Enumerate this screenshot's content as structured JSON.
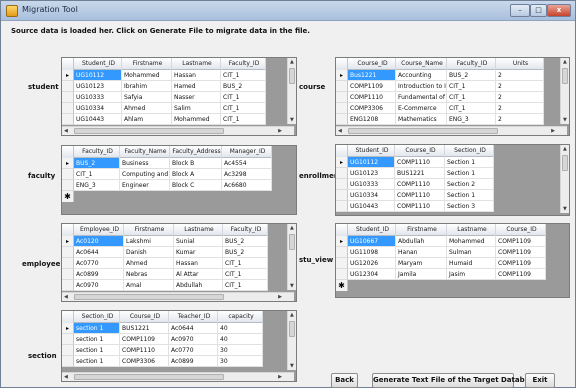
{
  "window": {
    "title": "Migration Tool",
    "minimize": "–",
    "maximize": "□",
    "close": "x"
  },
  "info_text": "Source data is loaded her. Click on Generate File to migrate data in the file.",
  "labels": {
    "student": "student",
    "faculty": "faculty",
    "employee": "employee",
    "section": "section",
    "course": "course",
    "enrollment": "enrollment",
    "stu_view": "stu_view"
  },
  "grids": {
    "student": {
      "columns": [
        "Student_ID",
        "Firstname",
        "Lastname",
        "Faculty_ID"
      ],
      "rows": [
        [
          "UG10112",
          "Mohammed",
          "Hassan",
          "CIT_1"
        ],
        [
          "UG10123",
          "Ibrahim",
          "Hamed",
          "BUS_2"
        ],
        [
          "UG10333",
          "Safyia",
          "Nasser",
          "CIT_1"
        ],
        [
          "UG10334",
          "Ahmed",
          "Salim",
          "CIT_1"
        ],
        [
          "UG10443",
          "Ahlam",
          "Mohammed",
          "CIT_1"
        ]
      ]
    },
    "faculty": {
      "columns": [
        "Faculty_ID",
        "Faculty_Name",
        "Faculty_Address",
        "Manager_ID"
      ],
      "rows": [
        [
          "BUS_2",
          "Business",
          "Block B",
          "Ac4554"
        ],
        [
          "CIT_1",
          "Computing and I...",
          "Block A",
          "Ac3298"
        ],
        [
          "ENG_3",
          "Engineer",
          "Block C",
          "Ac6680"
        ]
      ]
    },
    "employee": {
      "columns": [
        "Employee_ID",
        "Firstname",
        "Lastname",
        "Faculty_ID"
      ],
      "rows": [
        [
          "Ac0120",
          "Lakshmi",
          "Sunial",
          "BUS_2"
        ],
        [
          "Ac0644",
          "Danish",
          "Kumar",
          "BUS_2"
        ],
        [
          "Ac0770",
          "Ahmed",
          "Hassan",
          "CIT_1"
        ],
        [
          "Ac0899",
          "Nebras",
          "Al Attar",
          "CIT_1"
        ],
        [
          "Ac0970",
          "Amal",
          "Abdullah",
          "CIT_1"
        ]
      ]
    },
    "section": {
      "columns": [
        "Section_ID",
        "Course_ID",
        "Teacher_ID",
        "capacity"
      ],
      "rows": [
        [
          "section 1",
          "BUS1221",
          "Ac0644",
          "40"
        ],
        [
          "section 1",
          "COMP1109",
          "Ac0970",
          "40"
        ],
        [
          "section 1",
          "COMP1110",
          "Ac0770",
          "30"
        ],
        [
          "section 1",
          "COMP3306",
          "Ac0899",
          "30"
        ]
      ]
    },
    "course": {
      "columns": [
        "Course_ID",
        "Course_Name",
        "Faculty_ID",
        "Units"
      ],
      "rows": [
        [
          "Bus1221",
          "Accounting",
          "BUS_2",
          "2"
        ],
        [
          "COMP1109",
          "Introduction to I...",
          "CIT_1",
          "2"
        ],
        [
          "COMP1110",
          "Fundamental of ...",
          "CIT_1",
          "2"
        ],
        [
          "COMP3306",
          "E-Commerce",
          "CIT_1",
          "2"
        ],
        [
          "ENG1208",
          "Mathematics",
          "ENG_3",
          "2"
        ]
      ]
    },
    "enrollment": {
      "columns": [
        "Student_ID",
        "Course_ID",
        "Section_ID"
      ],
      "rows": [
        [
          "UG10112",
          "COMP1110",
          "Section 1"
        ],
        [
          "UG10123",
          "BUS1221",
          "Section 1"
        ],
        [
          "UG10333",
          "COMP1110",
          "Section 2"
        ],
        [
          "UG10334",
          "COMP1110",
          "Section 1"
        ],
        [
          "UG10443",
          "COMP1110",
          "Section 3"
        ]
      ]
    },
    "stu_view": {
      "columns": [
        "Student_ID",
        "Firstname",
        "Lastname",
        "Course_ID"
      ],
      "rows": [
        [
          "UG10667",
          "Abdullah",
          "Mohammed",
          "COMP1109"
        ],
        [
          "UG11098",
          "Hanan",
          "Sulman",
          "COMP1109"
        ],
        [
          "UG12026",
          "Maryam",
          "Humaid",
          "COMP1109"
        ],
        [
          "UG12304",
          "Jamila",
          "Jasim",
          "COMP1109"
        ]
      ]
    }
  },
  "row_markers": {
    "current": "▸",
    "new": "✱"
  },
  "buttons": {
    "back": "Back",
    "generate": "Generate Text File of the Target Database",
    "exit": "Exit"
  }
}
